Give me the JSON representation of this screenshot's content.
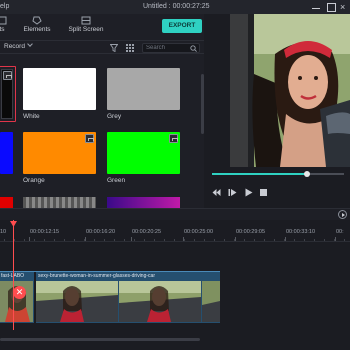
{
  "window": {
    "menu_help": "elp",
    "title": "Untitled : 00:00:27:25"
  },
  "tabs": [
    {
      "label": "ts",
      "icon": "media-icon"
    },
    {
      "label": "Elements",
      "icon": "elements-icon"
    },
    {
      "label": "Split Screen",
      "icon": "split-screen-icon"
    }
  ],
  "export_label": "EXPORT",
  "toolbar": {
    "record_label": "Record",
    "search_placeholder": "Search"
  },
  "swatches": [
    {
      "label": "",
      "color": "#0a0a0a",
      "selected": true
    },
    {
      "label": "White",
      "color": "#ffffff"
    },
    {
      "label": "Grey",
      "color": "#a8a8a8"
    },
    {
      "label": "",
      "color": "#0a0aff"
    },
    {
      "label": "Orange",
      "color": "#ff8a00"
    },
    {
      "label": "Green",
      "color": "#00ff00"
    }
  ],
  "accent_color": "#2fd1c2",
  "playhead_color": "#ff4d4f",
  "playback": {
    "progress": 0.72,
    "controls": [
      "rewind",
      "play-step",
      "play",
      "stop"
    ]
  },
  "ruler_labels": [
    "10",
    "00:00:12:15",
    "00:00:16:20",
    "00:00:20:25",
    "00:00:25:00",
    "00:00:29:05",
    "00:00:33:10",
    "00:"
  ],
  "clips": [
    {
      "title": "fast-LABO"
    },
    {
      "title": "sexy-brunette-woman-in-summer-glasses-driving-car"
    }
  ]
}
